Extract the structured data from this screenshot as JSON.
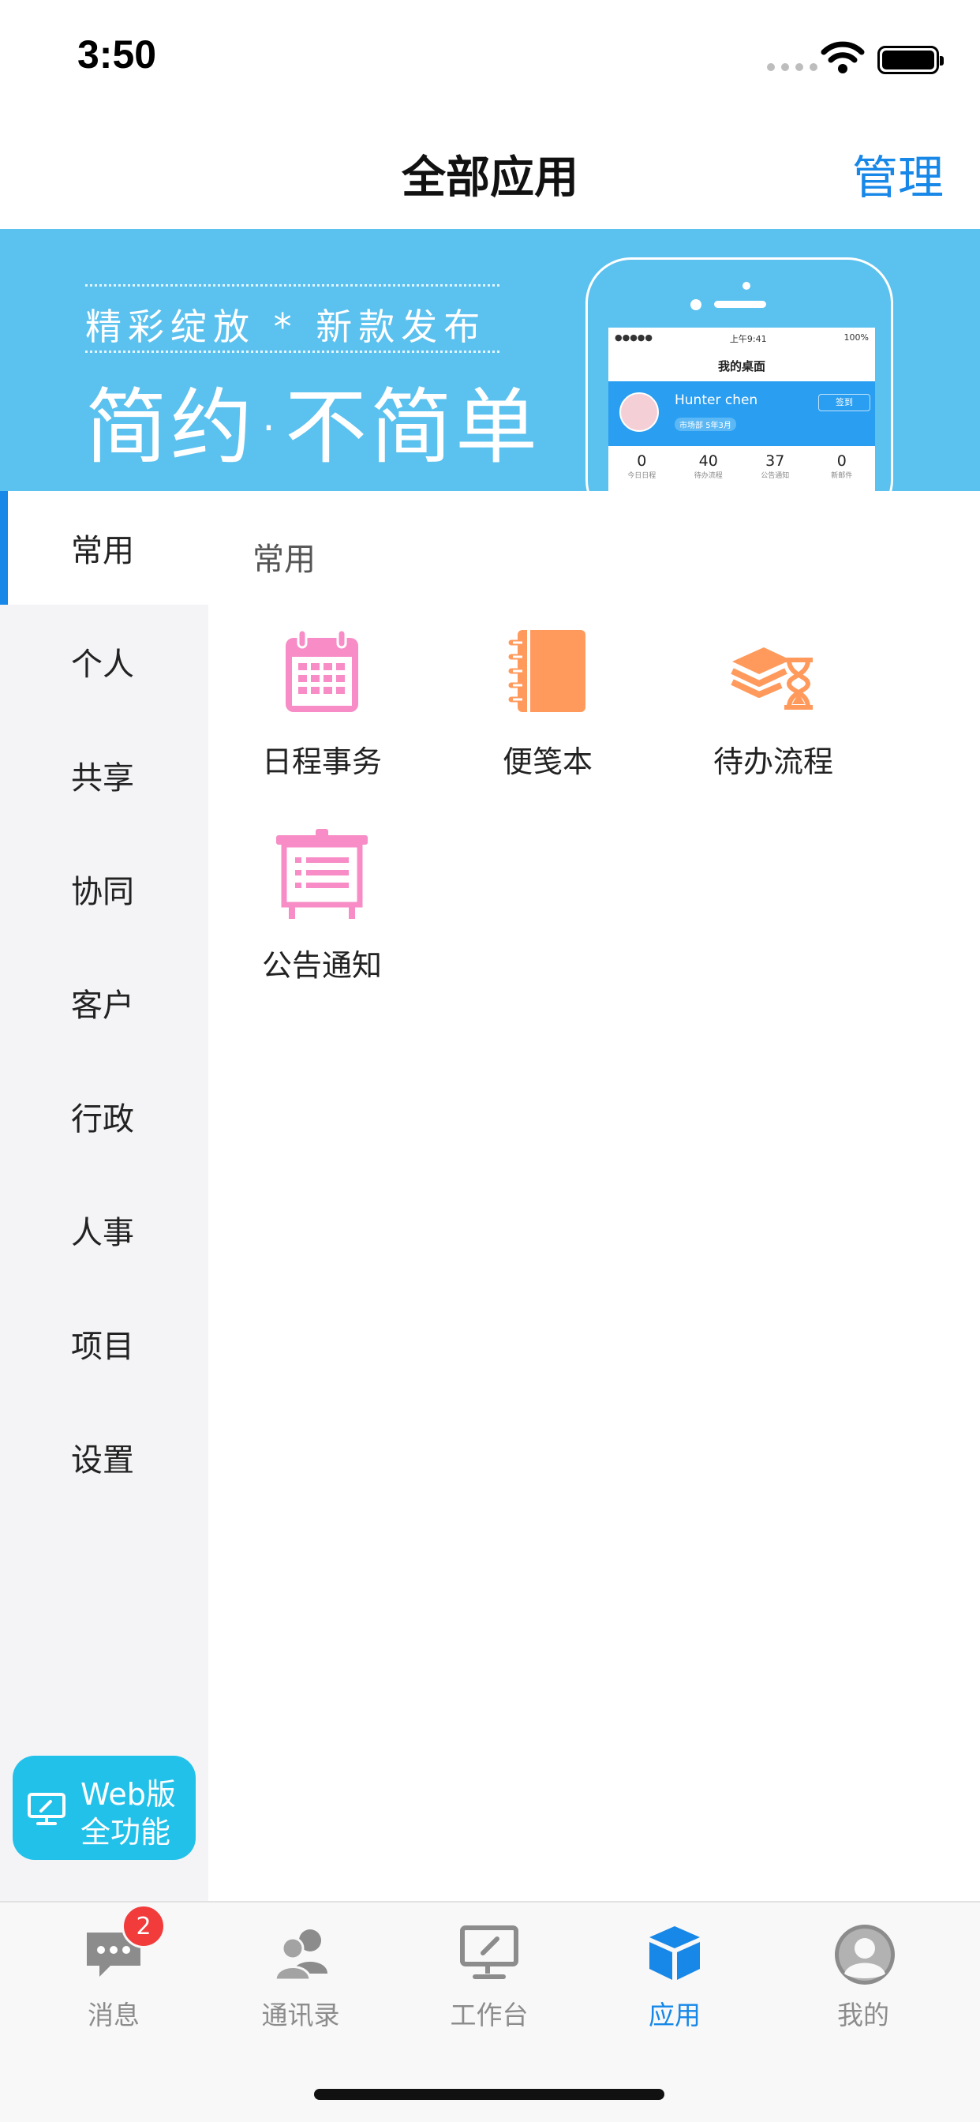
{
  "status": {
    "time": "3:50"
  },
  "nav": {
    "title": "全部应用",
    "manage": "管理"
  },
  "banner": {
    "subtitle": "精彩绽放 * 新款发布",
    "headline": "简约·不简单",
    "phone": {
      "carrier": "●●●●● ",
      "clock": "上午9:41",
      "battery": "100%",
      "title": "我的桌面",
      "user": "Hunter chen",
      "tag": "市场部",
      "tag2": "5年3月",
      "btn": "签到",
      "stats": [
        {
          "n": "0",
          "l": "今日日程"
        },
        {
          "n": "40",
          "l": "待办流程"
        },
        {
          "n": "37",
          "l": "公告通知"
        },
        {
          "n": "0",
          "l": "新邮件"
        }
      ]
    }
  },
  "sidebar": {
    "items": [
      {
        "label": "常用"
      },
      {
        "label": "个人"
      },
      {
        "label": "共享"
      },
      {
        "label": "协同"
      },
      {
        "label": "客户"
      },
      {
        "label": "行政"
      },
      {
        "label": "人事"
      },
      {
        "label": "项目"
      },
      {
        "label": "设置"
      }
    ],
    "web": {
      "line1": "Web版",
      "line2": "全功能"
    }
  },
  "content": {
    "section": "常用",
    "apps": [
      {
        "label": "日程事务",
        "icon": "calendar-icon",
        "color": "#f78cc6"
      },
      {
        "label": "便笺本",
        "icon": "notebook-icon",
        "color": "#ff9a5c"
      },
      {
        "label": "待办流程",
        "icon": "layers-hourglass-icon",
        "color": "#ff9a5c"
      },
      {
        "label": "公告通知",
        "icon": "noticeboard-icon",
        "color": "#f78cc6"
      }
    ]
  },
  "tabbar": {
    "tabs": [
      {
        "label": "消息",
        "badge": "2"
      },
      {
        "label": "通讯录"
      },
      {
        "label": "工作台"
      },
      {
        "label": "应用"
      },
      {
        "label": "我的"
      }
    ]
  },
  "colors": {
    "accent": "#1787e8",
    "banner": "#5bc1ef",
    "pink": "#f78cc6",
    "orange": "#ff9a5c",
    "badge": "#f23b3b"
  }
}
